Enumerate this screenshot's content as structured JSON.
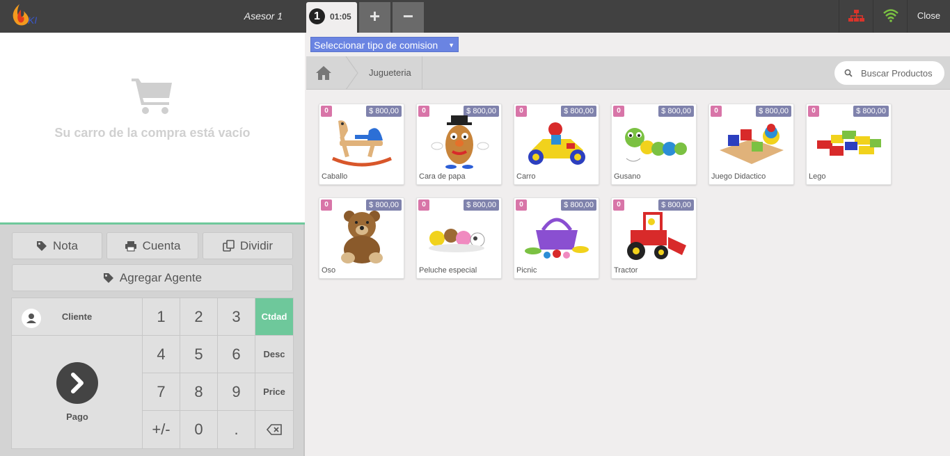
{
  "header": {
    "cashier": "Asesor 1",
    "order": {
      "number": "1",
      "time": "01:05"
    },
    "add_order_label": "+",
    "remove_order_label": "−",
    "network_icon": "sitemap-icon",
    "wifi_icon": "wifi-icon",
    "close_label": "Close",
    "colors": {
      "network": "#d9342b",
      "wifi": "#7bc142"
    }
  },
  "order_area": {
    "empty_message": "Su carro de la compra está vacío",
    "icon": "shopping-cart-icon"
  },
  "controls": {
    "nota": "Nota",
    "cuenta": "Cuenta",
    "dividir": "Dividir",
    "agregar_agente": "Agregar Agente"
  },
  "numpad": {
    "cliente": "Cliente",
    "pago": "Pago",
    "keys": [
      "1",
      "2",
      "3",
      "4",
      "5",
      "6",
      "7",
      "8",
      "9",
      "+/-",
      "0",
      "."
    ],
    "modes": {
      "qty": "Ctdad",
      "disc": "Desc",
      "price": "Price"
    },
    "backspace_icon": "backspace-icon",
    "active_color": "#6ec89b"
  },
  "comision": {
    "label": "Seleccionar tipo de comision",
    "caret": "▼"
  },
  "breadcrumb": {
    "home_icon": "home-icon",
    "category": "Jugueteria"
  },
  "search": {
    "placeholder": "Buscar Productos"
  },
  "products": [
    {
      "name": "Caballo",
      "price": "$ 800,00",
      "qty": "0"
    },
    {
      "name": "Cara de papa",
      "price": "$ 800,00",
      "qty": "0"
    },
    {
      "name": "Carro",
      "price": "$ 800,00",
      "qty": "0"
    },
    {
      "name": "Gusano",
      "price": "$ 800,00",
      "qty": "0"
    },
    {
      "name": "Juego Didactico",
      "price": "$ 800,00",
      "qty": "0"
    },
    {
      "name": "Lego",
      "price": "$ 800,00",
      "qty": "0"
    },
    {
      "name": "Oso",
      "price": "$ 800,00",
      "qty": "0"
    },
    {
      "name": "Peluche especial",
      "price": "$ 800,00",
      "qty": "0"
    },
    {
      "name": "Picnic",
      "price": "$ 800,00",
      "qty": "0"
    },
    {
      "name": "Tractor",
      "price": "$ 800,00",
      "qty": "0"
    }
  ]
}
